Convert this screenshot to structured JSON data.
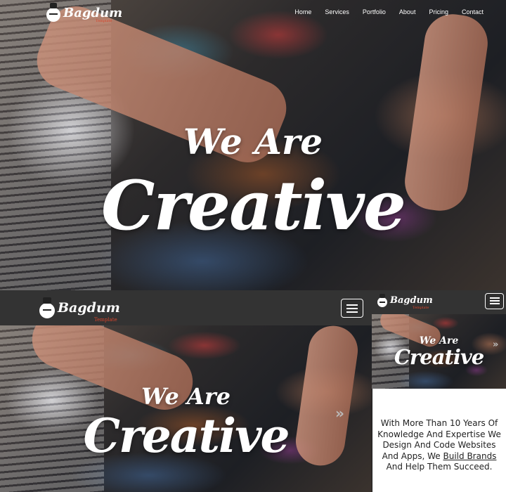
{
  "brand": {
    "name": "Bagdum",
    "tagline": "Template"
  },
  "nav": [
    "Home",
    "Services",
    "Portfolio",
    "About",
    "Pricing",
    "Contact"
  ],
  "hero": {
    "line1": "We Are",
    "line2": "Creative"
  },
  "about": {
    "before": "With More Than 10 Years Of Knowledge And Expertise We Design And Code Websites And Apps, We ",
    "link": "Build Brands",
    "after": " And Help Them Succeed."
  },
  "icons": {
    "menu": "hamburger-menu-icon",
    "next": "chevron-right-icon",
    "logo": "clown-face-icon"
  },
  "colors": {
    "navbar": "#333333",
    "accent": "#d8442b",
    "text": "#ffffff"
  }
}
